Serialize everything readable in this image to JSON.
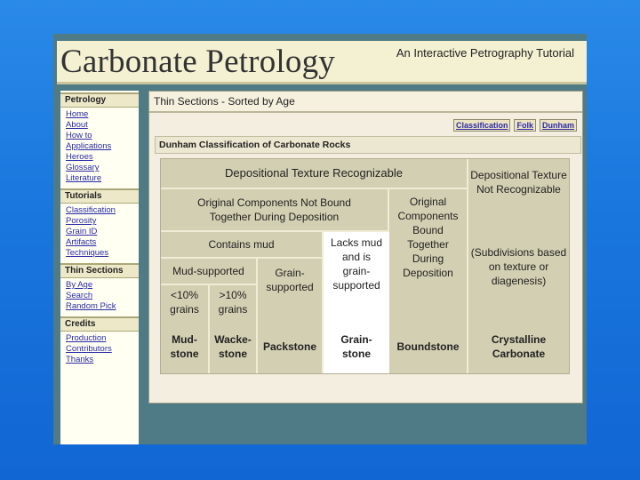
{
  "header": {
    "title": "Carbonate Petrology",
    "subtitle": "An Interactive Petrography Tutorial"
  },
  "nav": {
    "sections": [
      {
        "heading": "Petrology",
        "items": [
          "Home",
          "About",
          "How to",
          "Applications",
          "Heroes",
          "Glossary",
          "Literature"
        ]
      },
      {
        "heading": "Tutorials",
        "items": [
          "Classification",
          "Porosity",
          "Grain ID",
          "Artifacts",
          "Techniques"
        ]
      },
      {
        "heading": "Thin Sections",
        "items": [
          "By Age",
          "Search",
          "Random Pick"
        ]
      },
      {
        "heading": "Credits",
        "items": [
          "Production",
          "Contributors",
          "Thanks"
        ]
      }
    ]
  },
  "main": {
    "title": "Thin Sections - Sorted by Age",
    "tabs": [
      "Classification",
      "Folk",
      "Dunham"
    ],
    "panel_title": "Dunham Classification of Carbonate Rocks"
  },
  "table": {
    "depositional_texture": "Depositional Texture Recognizable",
    "not_bound": "Original Components Not Bound Together During Deposition",
    "contains_mud": "Contains mud",
    "mud_supported": "Mud-supported",
    "lt10": "<10% grains",
    "gt10": ">10% grains",
    "grain_supported": "Grain-supported",
    "lacks_mud": "Lacks mud and is grain-supported",
    "bound": "Original Components Bound Together During Deposition",
    "not_recognizable": "Depositional Texture Not Recognizable",
    "subdivisions": "(Subdivisions based on texture or diagenesis)",
    "mudstone": "Mud-stone",
    "wackestone": "Wacke-stone",
    "packstone": "Packstone",
    "grainstone": "Grain-stone",
    "boundstone": "Boundstone",
    "crystalline": "Crystalline Carbonate"
  }
}
